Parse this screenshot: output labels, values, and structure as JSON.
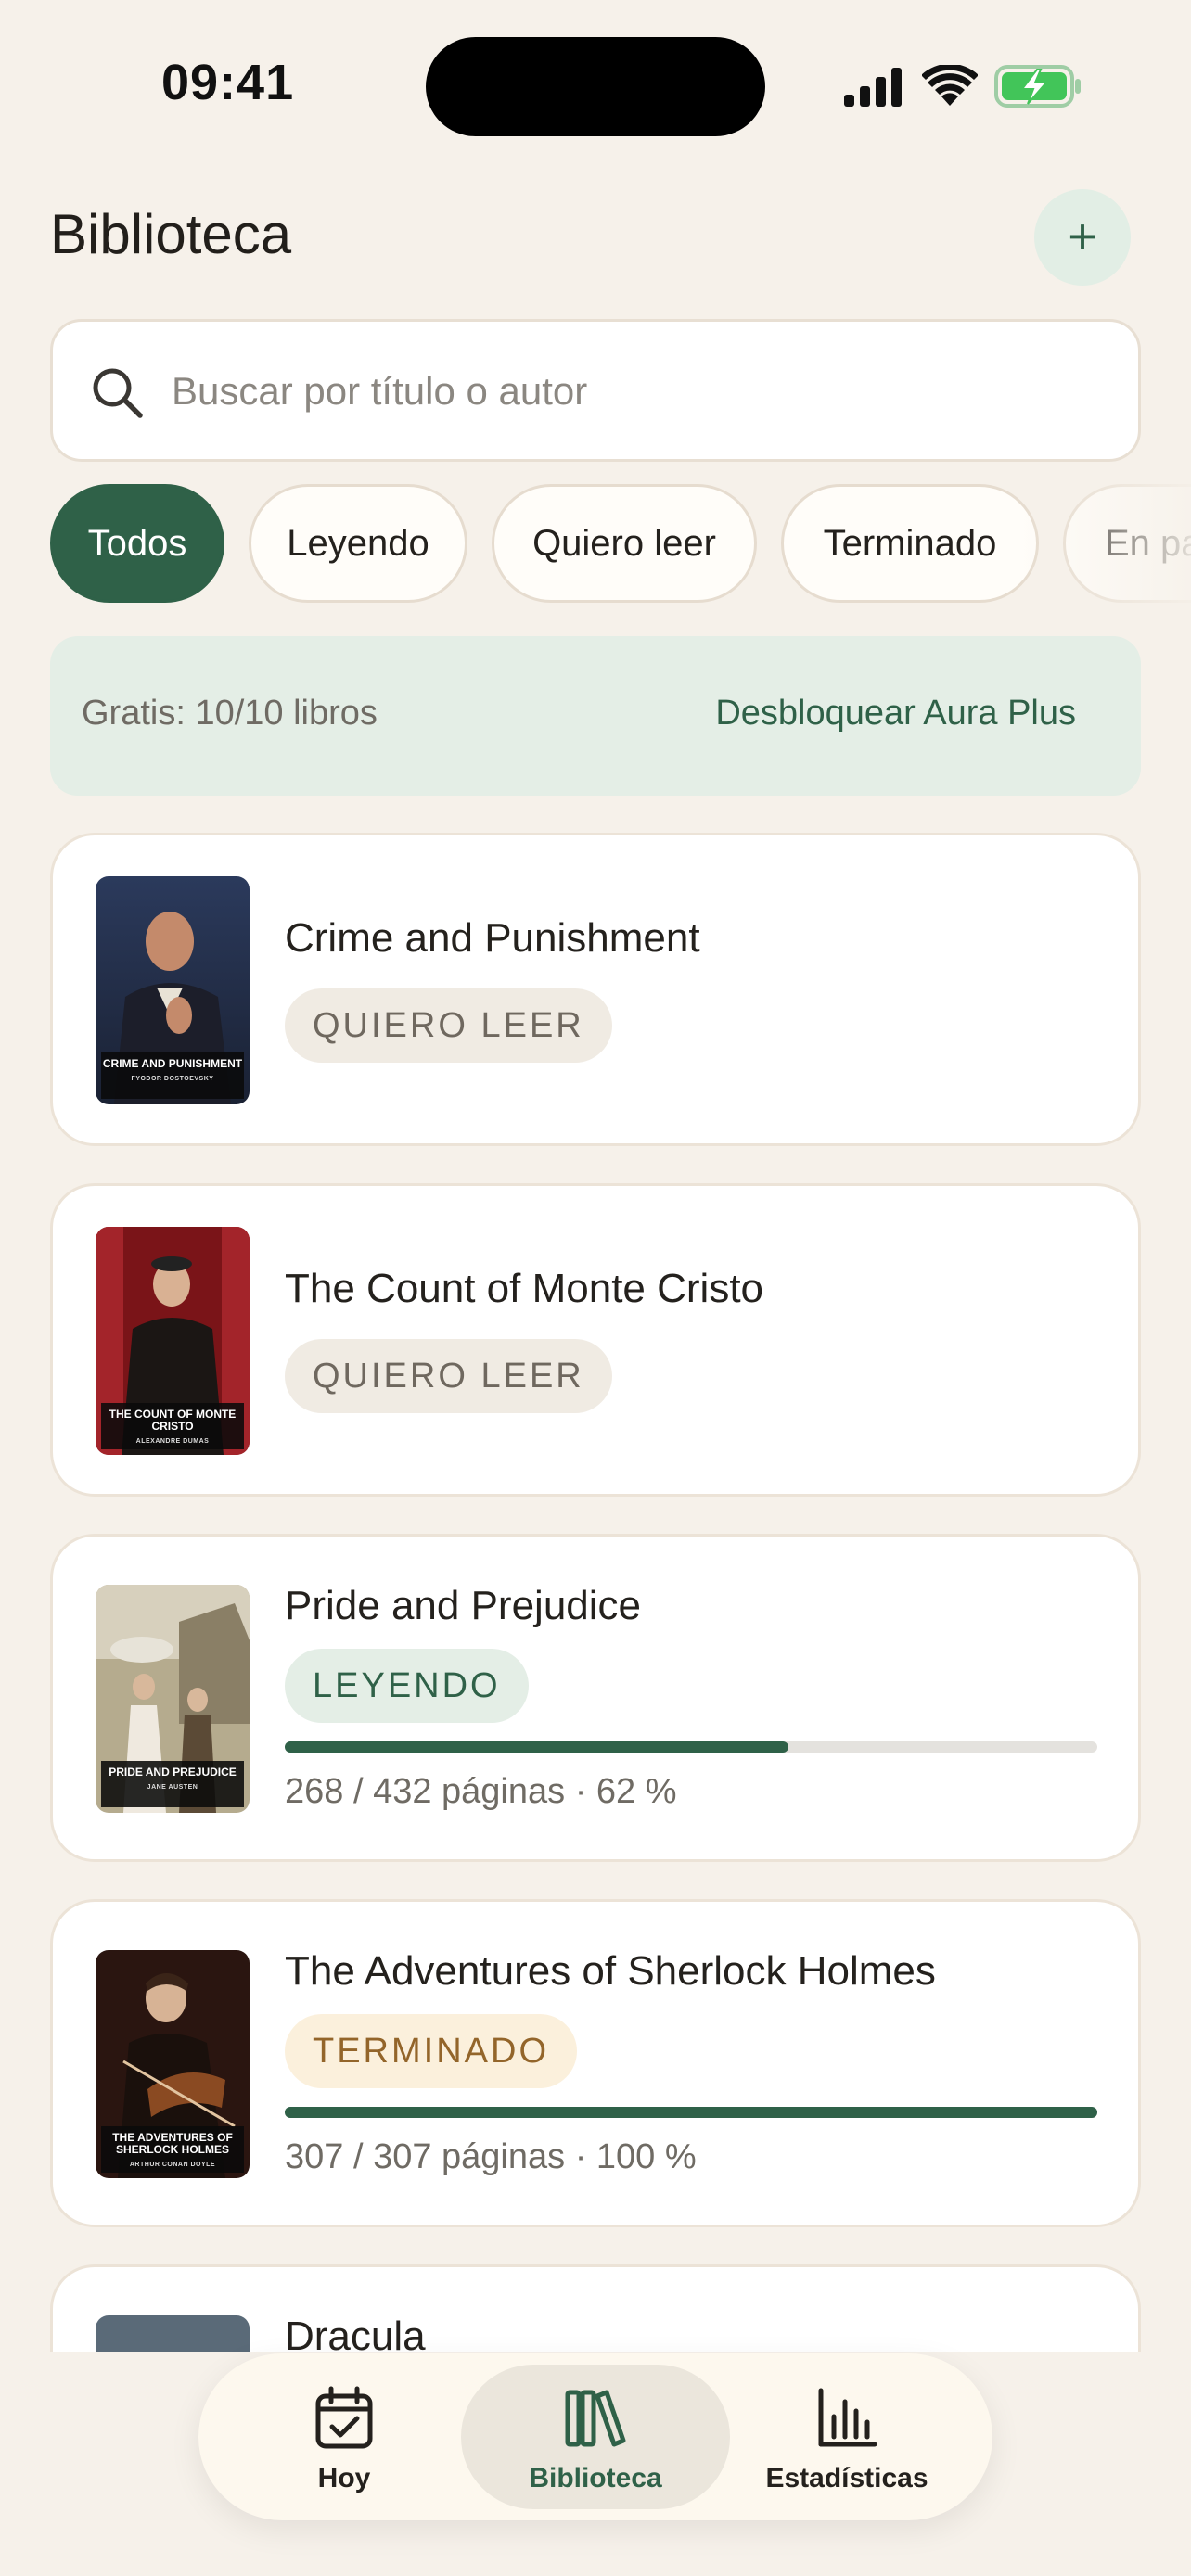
{
  "status_bar": {
    "time": "09:41",
    "icons": [
      "cellular-signal-icon",
      "wifi-icon",
      "battery-charging-icon"
    ]
  },
  "header": {
    "title": "Biblioteca",
    "add_label": "+"
  },
  "search": {
    "placeholder": "Buscar por título o autor",
    "value": ""
  },
  "filters": {
    "selected": "Todos",
    "items": [
      {
        "label": "Todos"
      },
      {
        "label": "Leyendo"
      },
      {
        "label": "Quiero leer"
      },
      {
        "label": "Terminado"
      },
      {
        "label": "En pa"
      }
    ]
  },
  "plan": {
    "status": "Gratis: 10/10 libros",
    "upgrade_label": "Desbloquear Aura Plus"
  },
  "books": [
    {
      "title": "Crime and Punishment",
      "status": "QUIERO LEER",
      "cover_title": "CRIME AND PUNISHMENT",
      "cover_author": "FYODOR DOSTOEVSKY"
    },
    {
      "title": "The Count of Monte Cristo",
      "status": "QUIERO LEER",
      "cover_title": "THE COUNT OF MONTE CRISTO",
      "cover_author": "ALEXANDRE DUMAS"
    },
    {
      "title": "Pride and Prejudice",
      "status": "LEYENDO",
      "progress_fraction": 0.62,
      "progress_text": "268 / 432 páginas · 62 %",
      "cover_title": "PRIDE AND PREJUDICE",
      "cover_author": "JANE AUSTEN"
    },
    {
      "title": "The Adventures of Sherlock Holmes",
      "status": "TERMINADO",
      "progress_fraction": 1.0,
      "progress_text": "307 / 307 páginas · 100 %",
      "cover_title": "THE ADVENTURES OF SHERLOCK HOLMES",
      "cover_author": "ARTHUR CONAN DOYLE"
    },
    {
      "title": "Dracula"
    }
  ],
  "tab_bar": {
    "active": "Biblioteca",
    "tabs": [
      {
        "label": "Hoy",
        "icon": "calendar-check-icon"
      },
      {
        "label": "Biblioteca",
        "icon": "books-icon"
      },
      {
        "label": "Estadísticas",
        "icon": "bar-chart-icon"
      }
    ]
  },
  "colors": {
    "background": "#f6f1ea",
    "accent": "#2f6148",
    "accent_soft": "#e4eee6",
    "finished_text": "#93652a",
    "finished_bg": "#fbf0dc"
  }
}
